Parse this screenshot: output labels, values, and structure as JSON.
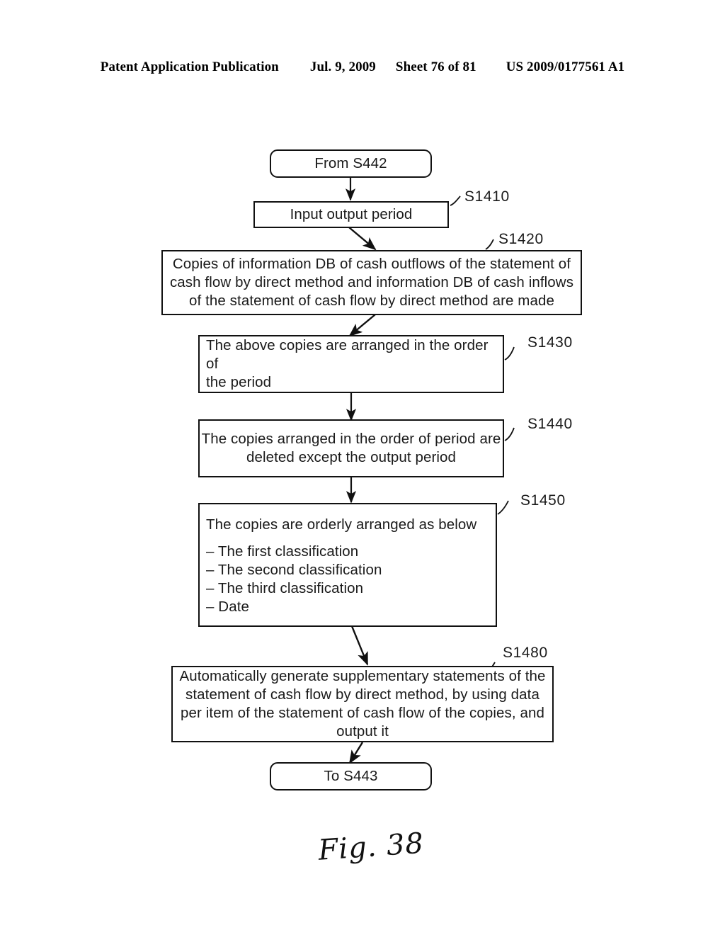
{
  "header": {
    "publication": "Patent Application Publication",
    "date": "Jul. 9, 2009",
    "sheet": "Sheet 76 of 81",
    "patent_number": "US 2009/0177561 A1"
  },
  "figure": {
    "caption": "Fig. 38"
  },
  "flowchart": {
    "start": {
      "label": "From S442"
    },
    "end": {
      "label": "To S443"
    },
    "steps": [
      {
        "id": "S1410",
        "step_label": "S1410",
        "lines": [
          "Input output period"
        ],
        "align": "center"
      },
      {
        "id": "S1420",
        "step_label": "S1420",
        "lines": [
          "Copies of information DB of cash outflows of the statement of",
          "cash flow by direct method and  information DB of cash inflows",
          "of the statement of cash flow by direct method are made"
        ],
        "align": "center"
      },
      {
        "id": "S1430",
        "step_label": "S1430",
        "lines": [
          "The above copies are arranged in the order of",
          "the period"
        ],
        "align": "left"
      },
      {
        "id": "S1440",
        "step_label": "S1440",
        "lines": [
          "The copies arranged in the order of period are",
          "deleted except the output period"
        ],
        "align": "center"
      },
      {
        "id": "S1450",
        "step_label": "S1450",
        "lines": [
          "The copies are orderly arranged as below",
          "",
          "– The first classification",
          "– The second classification",
          "– The third classification",
          "– Date"
        ],
        "align": "left"
      },
      {
        "id": "S1480",
        "step_label": "S1480",
        "lines": [
          "Automatically generate supplementary statements of the",
          "statement of cash flow by direct method, by using data",
          "per item of the statement of cash flow of the copies, and",
          "output it"
        ],
        "align": "center"
      }
    ]
  },
  "colors": {
    "ink": "#111111",
    "paper": "#ffffff"
  }
}
